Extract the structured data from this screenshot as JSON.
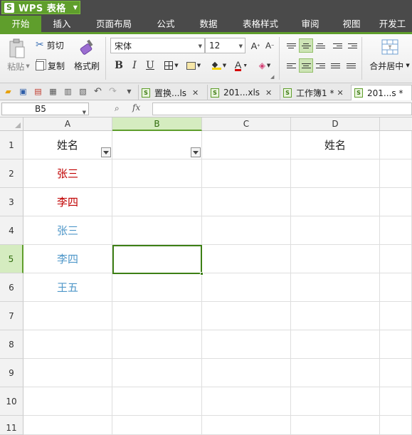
{
  "app": {
    "logo_letter": "S",
    "title": "WPS 表格",
    "accent_color": "#5f9e2c"
  },
  "menu": {
    "items": [
      "开始",
      "插入",
      "页面布局",
      "公式",
      "数据",
      "表格样式",
      "审阅",
      "视图",
      "开发工"
    ],
    "active": "开始"
  },
  "ribbon": {
    "paste_label": "粘贴",
    "cut_label": "剪切",
    "copy_label": "复制",
    "format_painter_label": "格式刷",
    "font_name": "宋体",
    "font_size": "12",
    "bold_label": "B",
    "italic_label": "I",
    "underline_label": "U",
    "font_color_label": "A",
    "merge_center_label": "合并居中"
  },
  "tabs": [
    {
      "label": "置换...ls",
      "active": false
    },
    {
      "label": "201...xls",
      "active": false
    },
    {
      "label": "工作簿1 *",
      "active": false
    },
    {
      "label": "201...s *",
      "active": true
    }
  ],
  "formula_bar": {
    "name_box": "B5",
    "fx_label": "fx",
    "formula": ""
  },
  "grid": {
    "columns": [
      "A",
      "B",
      "C",
      "D"
    ],
    "selected_column": "B",
    "rows": [
      "1",
      "2",
      "3",
      "4",
      "5",
      "6",
      "7",
      "8",
      "9",
      "10",
      "11"
    ],
    "selected_row": "5",
    "cells": {
      "A1": {
        "text": "姓名",
        "color": "#222222"
      },
      "D1": {
        "text": "姓名",
        "color": "#222222"
      },
      "A2": {
        "text": "张三",
        "color": "#c00000"
      },
      "A3": {
        "text": "李四",
        "color": "#c00000"
      },
      "A4": {
        "text": "张三",
        "color": "#4f97c9"
      },
      "A5": {
        "text": "李四",
        "color": "#4f97c9"
      },
      "A6": {
        "text": "王五",
        "color": "#4f97c9"
      }
    },
    "filter_buttons": [
      "A1",
      "B1"
    ],
    "active_cell": "B5"
  }
}
